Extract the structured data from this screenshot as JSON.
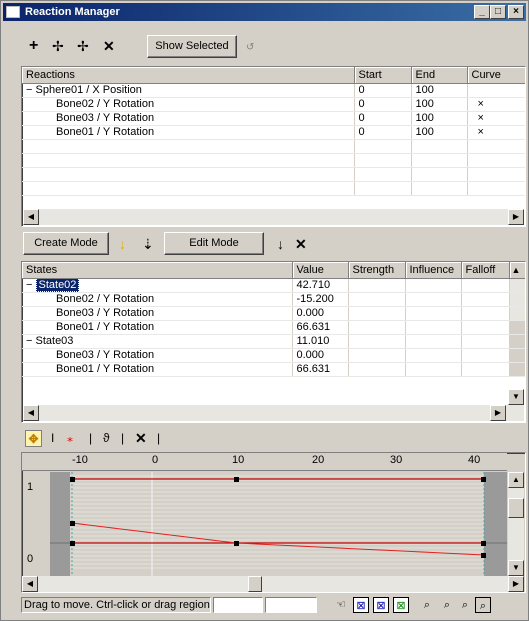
{
  "window": {
    "title": "Reaction Manager",
    "min": "_",
    "max": "□",
    "close": "×"
  },
  "toolbar": {
    "add_icon": "plus-icon",
    "show_selected_label": "Show Selected"
  },
  "reactions": {
    "columns": [
      "Reactions",
      "Start",
      "End",
      "Curve"
    ],
    "rows": [
      {
        "expander": "−",
        "name": "Sphere01 / X Position",
        "start": "0",
        "end": "100",
        "curve": ""
      },
      {
        "name": "Bone02 / Y Rotation",
        "start": "0",
        "end": "100",
        "curve": "×"
      },
      {
        "name": "Bone03 / Y Rotation",
        "start": "0",
        "end": "100",
        "curve": "×"
      },
      {
        "name": "Bone01 / Y Rotation",
        "start": "0",
        "end": "100",
        "curve": "×"
      }
    ]
  },
  "mode_bar": {
    "create_mode_label": "Create Mode",
    "edit_mode_label": "Edit Mode"
  },
  "states": {
    "columns": [
      "States",
      "Value",
      "Strength",
      "Influence",
      "Falloff"
    ],
    "rows": [
      {
        "expander": "−",
        "name": "State02",
        "value": "42.710",
        "selected": true
      },
      {
        "name": "Bone02 / Y Rotation",
        "value": "-15.200"
      },
      {
        "name": "Bone03 / Y Rotation",
        "value": "0.000"
      },
      {
        "name": "Bone01 / Y Rotation",
        "value": "66.631"
      },
      {
        "expander": "−",
        "name": "State03",
        "value": "11.010"
      },
      {
        "name": "Bone03 / Y Rotation",
        "value": "0.000"
      },
      {
        "name": "Bone01 / Y Rotation",
        "value": "66.631"
      }
    ]
  },
  "curve_editor": {
    "ruler_labels": [
      "-10",
      "0",
      "10",
      "20",
      "30",
      "40"
    ],
    "y_labels": [
      "1",
      "0"
    ]
  },
  "status": {
    "text": "Drag to move. Ctrl-click or drag region b"
  }
}
